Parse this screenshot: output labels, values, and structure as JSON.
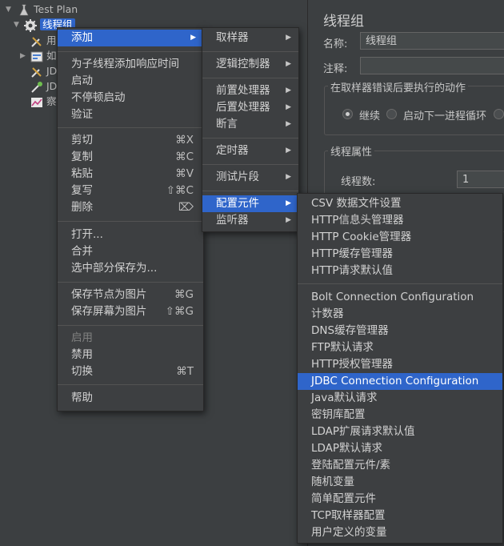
{
  "tree": {
    "root": "Test Plan",
    "thread_group": "线程组",
    "children": [
      "用",
      "如",
      "JD",
      "JD",
      "察"
    ]
  },
  "right_panel": {
    "title": "线程组",
    "name_label": "名称:",
    "name_value": "线程组",
    "comment_label": "注释:",
    "error_action_legend": "在取样器错误后要执行的动作",
    "radio_continue": "继续",
    "radio_next_loop": "启动下一进程循环",
    "props_legend": "线程属性",
    "threads_label": "线程数:",
    "threads_value": "1"
  },
  "context_menu": {
    "add": "添加",
    "add_think_time": "为子线程添加响应时间",
    "start": "启动",
    "start_no_pause": "不停顿启动",
    "validate": "验证",
    "cut": "剪切",
    "cut_key": "⌘X",
    "copy": "复制",
    "copy_key": "⌘C",
    "paste": "粘贴",
    "paste_key": "⌘V",
    "duplicate": "复写",
    "duplicate_key": "⇧⌘C",
    "delete": "删除",
    "delete_key": "⌦",
    "open": "打开...",
    "merge": "合并",
    "save_selection_as": "选中部分保存为...",
    "save_node_image": "保存节点为图片",
    "save_node_image_key": "⌘G",
    "save_screen_image": "保存屏幕为图片",
    "save_screen_image_key": "⇧⌘G",
    "enable": "启用",
    "disable": "禁用",
    "toggle": "切换",
    "toggle_key": "⌘T",
    "help": "帮助"
  },
  "add_menu": {
    "sampler": "取样器",
    "logic_controller": "逻辑控制器",
    "pre_processors": "前置处理器",
    "post_processors": "后置处理器",
    "assertions": "断言",
    "timer": "定时器",
    "test_fragment": "测试片段",
    "config_element": "配置元件",
    "listener": "监听器"
  },
  "config_menu": {
    "items_top": [
      "CSV 数据文件设置",
      "HTTP信息头管理器",
      "HTTP Cookie管理器",
      "HTTP缓存管理器",
      "HTTP请求默认值"
    ],
    "items_bottom": [
      "Bolt Connection Configuration",
      "计数器",
      "DNS缓存管理器",
      "FTP默认请求",
      "HTTP授权管理器",
      "JDBC Connection Configuration",
      "Java默认请求",
      "密钥库配置",
      "LDAP扩展请求默认值",
      "LDAP默认请求",
      "登陆配置元件/素",
      "随机变量",
      "简单配置元件",
      "TCP取样器配置",
      "用户定义的变量"
    ],
    "selected": "JDBC Connection Configuration"
  },
  "colors": {
    "selection": "#2f65ca",
    "background": "#3c3f41",
    "menu": "#3d3f41"
  }
}
